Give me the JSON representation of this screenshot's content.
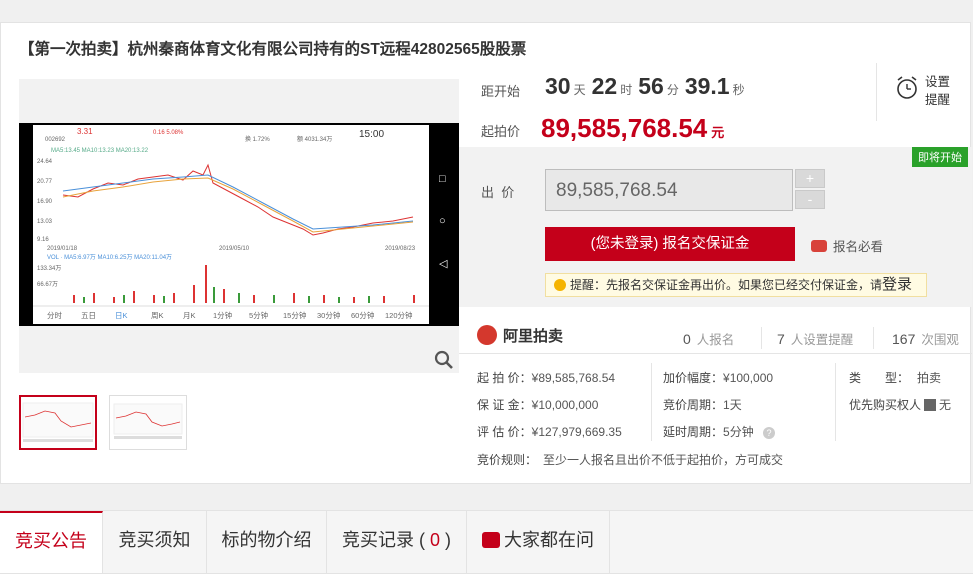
{
  "title": "【第一次拍卖】杭州秦商体育文化有限公司持有的ST远程42802565股股票",
  "countdown": {
    "label": "距开始",
    "days": "30",
    "days_unit": "天",
    "hours": "22",
    "hours_unit": "时",
    "minutes": "56",
    "minutes_unit": "分",
    "seconds": "39.1",
    "seconds_unit": "秒"
  },
  "remind": {
    "label": "设置提醒",
    "icon": "clock-bell-icon"
  },
  "start_price": {
    "label": "起拍价",
    "value": "89,585,768.54",
    "unit": "元"
  },
  "status_badge": "即将开始",
  "bid": {
    "label": "出  价",
    "value": "89,585,768.54",
    "plus": "+",
    "minus": "-",
    "register_button": "(您未登录) 报名交保证金",
    "must_read": "报名必看",
    "notice_prefix": "提醒：",
    "notice_text": "先报名交保证金再出价。如果您已经交付保证金，请",
    "notice_login": "登录"
  },
  "platform": "阿里拍卖",
  "stats": [
    {
      "num": "0",
      "label": "人报名"
    },
    {
      "num": "7",
      "label": "人设置提醒"
    },
    {
      "num": "167",
      "label": "次围观"
    }
  ],
  "info": {
    "col1": [
      {
        "k": "起 拍 价：",
        "v": "¥89,585,768.54"
      },
      {
        "k": "保 证 金：",
        "v": "¥10,000,000"
      },
      {
        "k": "评 估 价：",
        "v": "¥127,979,669.35"
      }
    ],
    "col2": [
      {
        "k": "加价幅度：",
        "v": "¥100,000"
      },
      {
        "k": "竞价周期：",
        "v": "1天"
      },
      {
        "k": "延时周期：",
        "v": "5分钟"
      }
    ],
    "col3": [
      {
        "k": "类　　型：",
        "v": "拍卖"
      },
      {
        "k": "优先购买权人",
        "v": "无"
      }
    ],
    "rule_k": "竞价规则：",
    "rule_v": "至少一人报名且出价不低于起拍价，方可成交"
  },
  "chart_screen": {
    "price": "3.31",
    "change": "0.16  5.08%",
    "code": "002692",
    "vol_label": "换 1.72%",
    "amount": "额 4031.34万",
    "time": "15:00",
    "ma": "MA5:13.45  MA10:13.23  MA20:13.22",
    "y_ticks": [
      "24.64",
      "20.77",
      "16.90",
      "13.03",
      "9.16"
    ],
    "dates": [
      "2019/01/18",
      "2019/05/10",
      "2019/08/23"
    ],
    "vol_ma": "VOL · MA5:6.97万  MA10:6.25万  MA20:11.04万",
    "vol_ticks": [
      "133.34万",
      "66.67万"
    ],
    "tabs": [
      "分时",
      "五日",
      "日K",
      "周K",
      "月K",
      "1分钟",
      "5分钟",
      "15分钟",
      "30分钟",
      "60分钟",
      "120分钟"
    ]
  },
  "tabs": [
    {
      "label": "竞买公告"
    },
    {
      "label": "竞买须知"
    },
    {
      "label": "标的物介绍"
    },
    {
      "label": "竞买记录",
      "count": "0"
    },
    {
      "label": "大家都在问"
    }
  ],
  "colors": {
    "accent": "#c4001a",
    "badge": "#2aa12a"
  }
}
